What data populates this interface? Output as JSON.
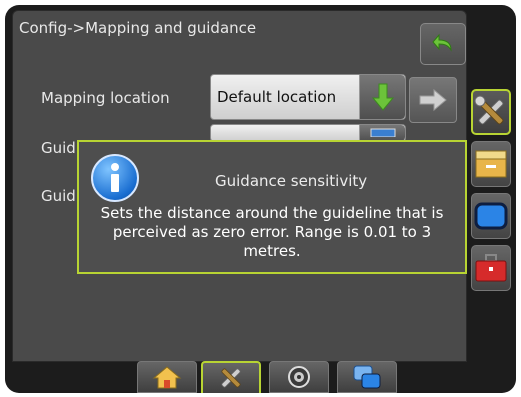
{
  "header": {
    "title": "Config->Mapping and guidance"
  },
  "rows": [
    {
      "label": "Mapping location",
      "value": "Default location"
    },
    {
      "label": "Guid",
      "value": ""
    },
    {
      "label": "Guid",
      "value": ""
    }
  ],
  "popup": {
    "title": "Guidance sensitivity",
    "message": "Sets the distance around the guideline that is perceived as zero error. Range is 0.01 to 3 metres."
  },
  "sidebar": {
    "items": [
      "tools-icon",
      "folder-box-icon",
      "display-icon",
      "toolbox-icon"
    ]
  },
  "bottom_tabs": {
    "items": [
      "home-icon",
      "tools-icon",
      "gauge-icon",
      "screens-icon"
    ]
  },
  "colors": {
    "accent": "#b8d433",
    "info": "#1a6ed1",
    "green_arrow": "#6cc33a"
  }
}
